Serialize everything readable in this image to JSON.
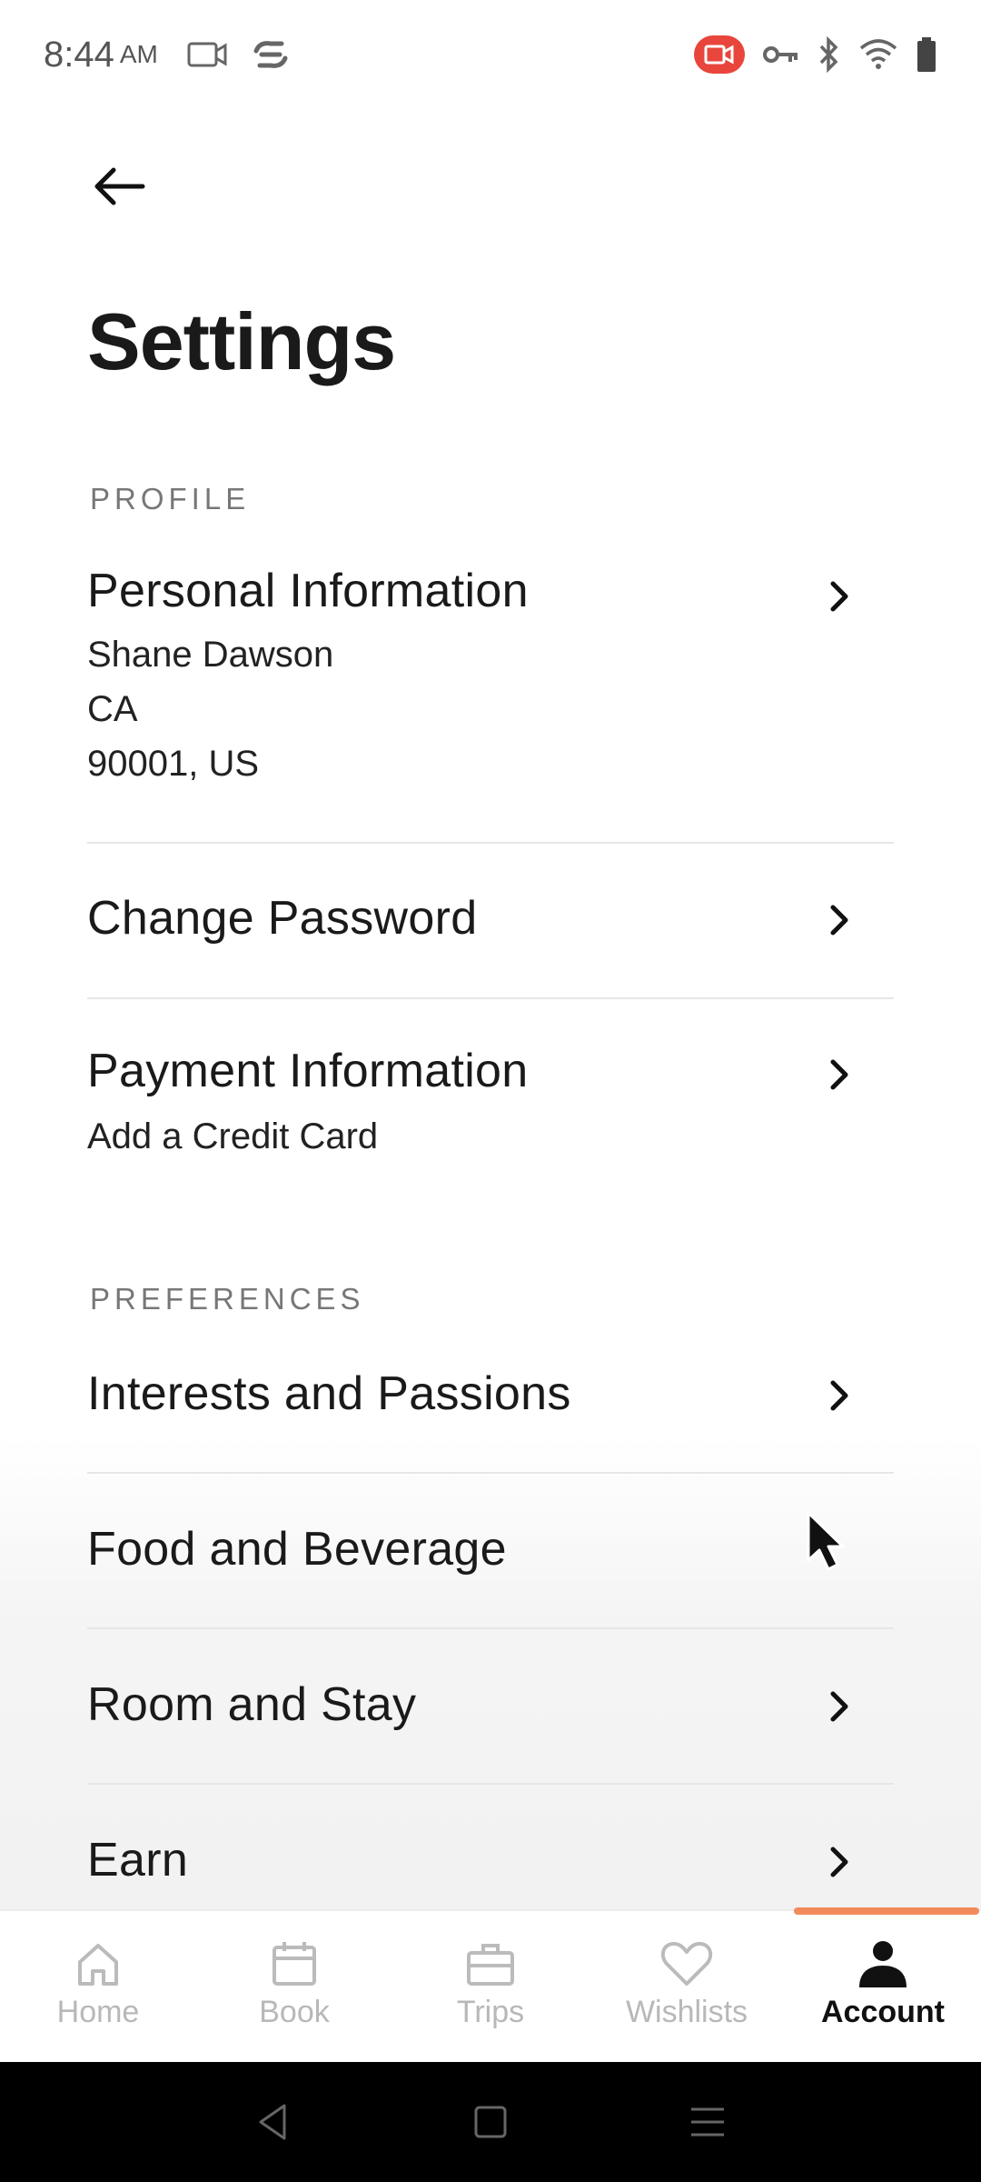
{
  "status_bar": {
    "time": "8:44",
    "ampm": "AM"
  },
  "header": {
    "title": "Settings"
  },
  "sections": {
    "profile": {
      "header": "PROFILE",
      "personal_information": {
        "title": "Personal Information",
        "name": "Shane Dawson",
        "state": "CA",
        "zip_country": "90001, US"
      },
      "change_password": {
        "title": "Change Password"
      },
      "payment_information": {
        "title": "Payment Information",
        "subtitle": "Add a Credit Card"
      }
    },
    "preferences": {
      "header": "PREFERENCES",
      "items": [
        {
          "title": "Interests and Passions"
        },
        {
          "title": "Food and Beverage"
        },
        {
          "title": "Room and Stay"
        },
        {
          "title": "Earn"
        }
      ]
    }
  },
  "bottom_nav": {
    "items": [
      {
        "label": "Home",
        "icon": "home-icon"
      },
      {
        "label": "Book",
        "icon": "calendar-icon"
      },
      {
        "label": "Trips",
        "icon": "briefcase-icon"
      },
      {
        "label": "Wishlists",
        "icon": "heart-icon"
      },
      {
        "label": "Account",
        "icon": "person-icon"
      }
    ],
    "active": "Account",
    "accent_color": "#f28a5c"
  }
}
